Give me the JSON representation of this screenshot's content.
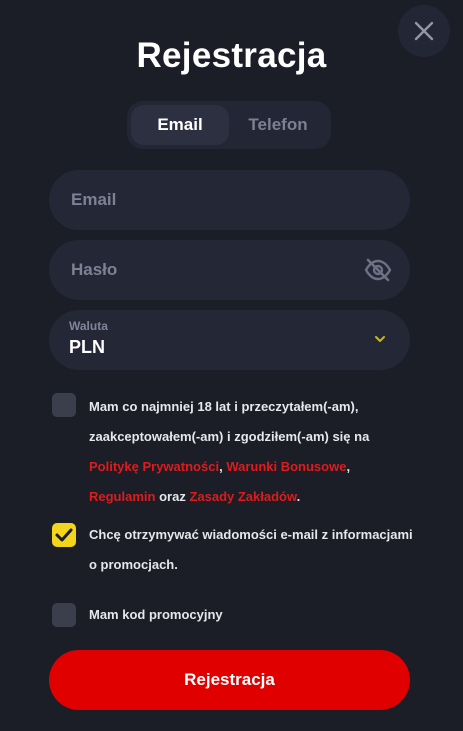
{
  "header": {
    "title": "Rejestracja",
    "close_icon": "close-icon"
  },
  "tabs": [
    {
      "label": "Email",
      "active": true
    },
    {
      "label": "Telefon",
      "active": false
    }
  ],
  "form": {
    "email": {
      "placeholder": "Email",
      "value": ""
    },
    "password": {
      "placeholder": "Hasło",
      "value": "",
      "icon": "eye-off-icon"
    },
    "currency": {
      "label": "Waluta",
      "value": "PLN",
      "icon": "chevron-down-icon"
    }
  },
  "consents": {
    "terms": {
      "checked": false,
      "line1": "Mam co najmniej 18 lat i przeczytałem(-am),",
      "line2": "zaakceptowałem(-am) i zgodziłem(-am) się na",
      "link_privacy": "Politykę Prywatności",
      "sep1": ",",
      "link_bonus": "Warunki Bonusowe",
      "sep2": ",",
      "link_rules": "Regulamin",
      "conj": "oraz",
      "link_betting": "Zasady Zakładów",
      "end": "."
    },
    "newsletter": {
      "checked": true,
      "line1": "Chcę otrzymywać wiadomości e-mail z informacjami",
      "line2": "o promocjach."
    },
    "promo": {
      "checked": false,
      "label": "Mam kod promocyjny"
    }
  },
  "submit": {
    "label": "Rejestracja"
  },
  "colors": {
    "background": "#1b1d27",
    "field": "#242735",
    "accent_red": "#e00000",
    "link_red": "#e01b1b",
    "checkbox_checked": "#f3d51b",
    "chevron": "#c9b81a"
  }
}
